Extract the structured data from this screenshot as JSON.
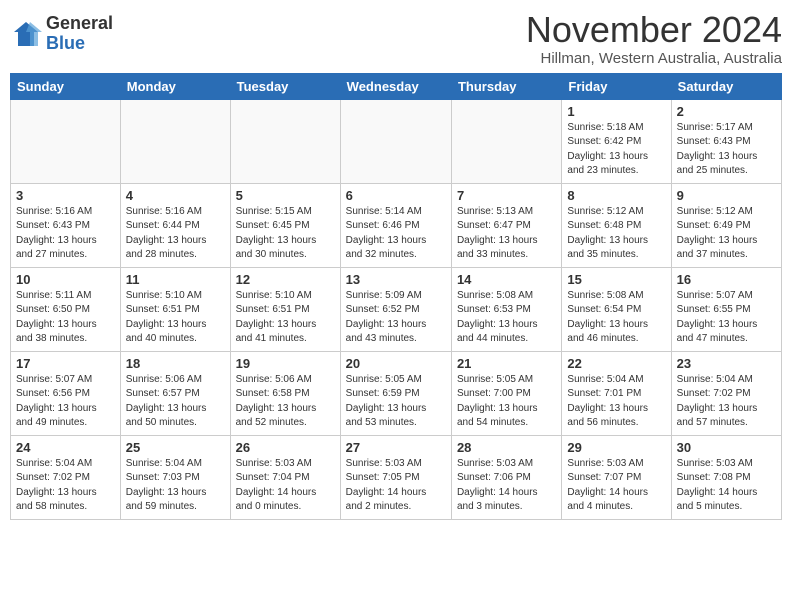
{
  "logo": {
    "general": "General",
    "blue": "Blue"
  },
  "title": {
    "month": "November 2024",
    "location": "Hillman, Western Australia, Australia"
  },
  "weekdays": [
    "Sunday",
    "Monday",
    "Tuesday",
    "Wednesday",
    "Thursday",
    "Friday",
    "Saturday"
  ],
  "weeks": [
    [
      {
        "day": "",
        "info": ""
      },
      {
        "day": "",
        "info": ""
      },
      {
        "day": "",
        "info": ""
      },
      {
        "day": "",
        "info": ""
      },
      {
        "day": "",
        "info": ""
      },
      {
        "day": "1",
        "info": "Sunrise: 5:18 AM\nSunset: 6:42 PM\nDaylight: 13 hours\nand 23 minutes."
      },
      {
        "day": "2",
        "info": "Sunrise: 5:17 AM\nSunset: 6:43 PM\nDaylight: 13 hours\nand 25 minutes."
      }
    ],
    [
      {
        "day": "3",
        "info": "Sunrise: 5:16 AM\nSunset: 6:43 PM\nDaylight: 13 hours\nand 27 minutes."
      },
      {
        "day": "4",
        "info": "Sunrise: 5:16 AM\nSunset: 6:44 PM\nDaylight: 13 hours\nand 28 minutes."
      },
      {
        "day": "5",
        "info": "Sunrise: 5:15 AM\nSunset: 6:45 PM\nDaylight: 13 hours\nand 30 minutes."
      },
      {
        "day": "6",
        "info": "Sunrise: 5:14 AM\nSunset: 6:46 PM\nDaylight: 13 hours\nand 32 minutes."
      },
      {
        "day": "7",
        "info": "Sunrise: 5:13 AM\nSunset: 6:47 PM\nDaylight: 13 hours\nand 33 minutes."
      },
      {
        "day": "8",
        "info": "Sunrise: 5:12 AM\nSunset: 6:48 PM\nDaylight: 13 hours\nand 35 minutes."
      },
      {
        "day": "9",
        "info": "Sunrise: 5:12 AM\nSunset: 6:49 PM\nDaylight: 13 hours\nand 37 minutes."
      }
    ],
    [
      {
        "day": "10",
        "info": "Sunrise: 5:11 AM\nSunset: 6:50 PM\nDaylight: 13 hours\nand 38 minutes."
      },
      {
        "day": "11",
        "info": "Sunrise: 5:10 AM\nSunset: 6:51 PM\nDaylight: 13 hours\nand 40 minutes."
      },
      {
        "day": "12",
        "info": "Sunrise: 5:10 AM\nSunset: 6:51 PM\nDaylight: 13 hours\nand 41 minutes."
      },
      {
        "day": "13",
        "info": "Sunrise: 5:09 AM\nSunset: 6:52 PM\nDaylight: 13 hours\nand 43 minutes."
      },
      {
        "day": "14",
        "info": "Sunrise: 5:08 AM\nSunset: 6:53 PM\nDaylight: 13 hours\nand 44 minutes."
      },
      {
        "day": "15",
        "info": "Sunrise: 5:08 AM\nSunset: 6:54 PM\nDaylight: 13 hours\nand 46 minutes."
      },
      {
        "day": "16",
        "info": "Sunrise: 5:07 AM\nSunset: 6:55 PM\nDaylight: 13 hours\nand 47 minutes."
      }
    ],
    [
      {
        "day": "17",
        "info": "Sunrise: 5:07 AM\nSunset: 6:56 PM\nDaylight: 13 hours\nand 49 minutes."
      },
      {
        "day": "18",
        "info": "Sunrise: 5:06 AM\nSunset: 6:57 PM\nDaylight: 13 hours\nand 50 minutes."
      },
      {
        "day": "19",
        "info": "Sunrise: 5:06 AM\nSunset: 6:58 PM\nDaylight: 13 hours\nand 52 minutes."
      },
      {
        "day": "20",
        "info": "Sunrise: 5:05 AM\nSunset: 6:59 PM\nDaylight: 13 hours\nand 53 minutes."
      },
      {
        "day": "21",
        "info": "Sunrise: 5:05 AM\nSunset: 7:00 PM\nDaylight: 13 hours\nand 54 minutes."
      },
      {
        "day": "22",
        "info": "Sunrise: 5:04 AM\nSunset: 7:01 PM\nDaylight: 13 hours\nand 56 minutes."
      },
      {
        "day": "23",
        "info": "Sunrise: 5:04 AM\nSunset: 7:02 PM\nDaylight: 13 hours\nand 57 minutes."
      }
    ],
    [
      {
        "day": "24",
        "info": "Sunrise: 5:04 AM\nSunset: 7:02 PM\nDaylight: 13 hours\nand 58 minutes."
      },
      {
        "day": "25",
        "info": "Sunrise: 5:04 AM\nSunset: 7:03 PM\nDaylight: 13 hours\nand 59 minutes."
      },
      {
        "day": "26",
        "info": "Sunrise: 5:03 AM\nSunset: 7:04 PM\nDaylight: 14 hours\nand 0 minutes."
      },
      {
        "day": "27",
        "info": "Sunrise: 5:03 AM\nSunset: 7:05 PM\nDaylight: 14 hours\nand 2 minutes."
      },
      {
        "day": "28",
        "info": "Sunrise: 5:03 AM\nSunset: 7:06 PM\nDaylight: 14 hours\nand 3 minutes."
      },
      {
        "day": "29",
        "info": "Sunrise: 5:03 AM\nSunset: 7:07 PM\nDaylight: 14 hours\nand 4 minutes."
      },
      {
        "day": "30",
        "info": "Sunrise: 5:03 AM\nSunset: 7:08 PM\nDaylight: 14 hours\nand 5 minutes."
      }
    ]
  ]
}
